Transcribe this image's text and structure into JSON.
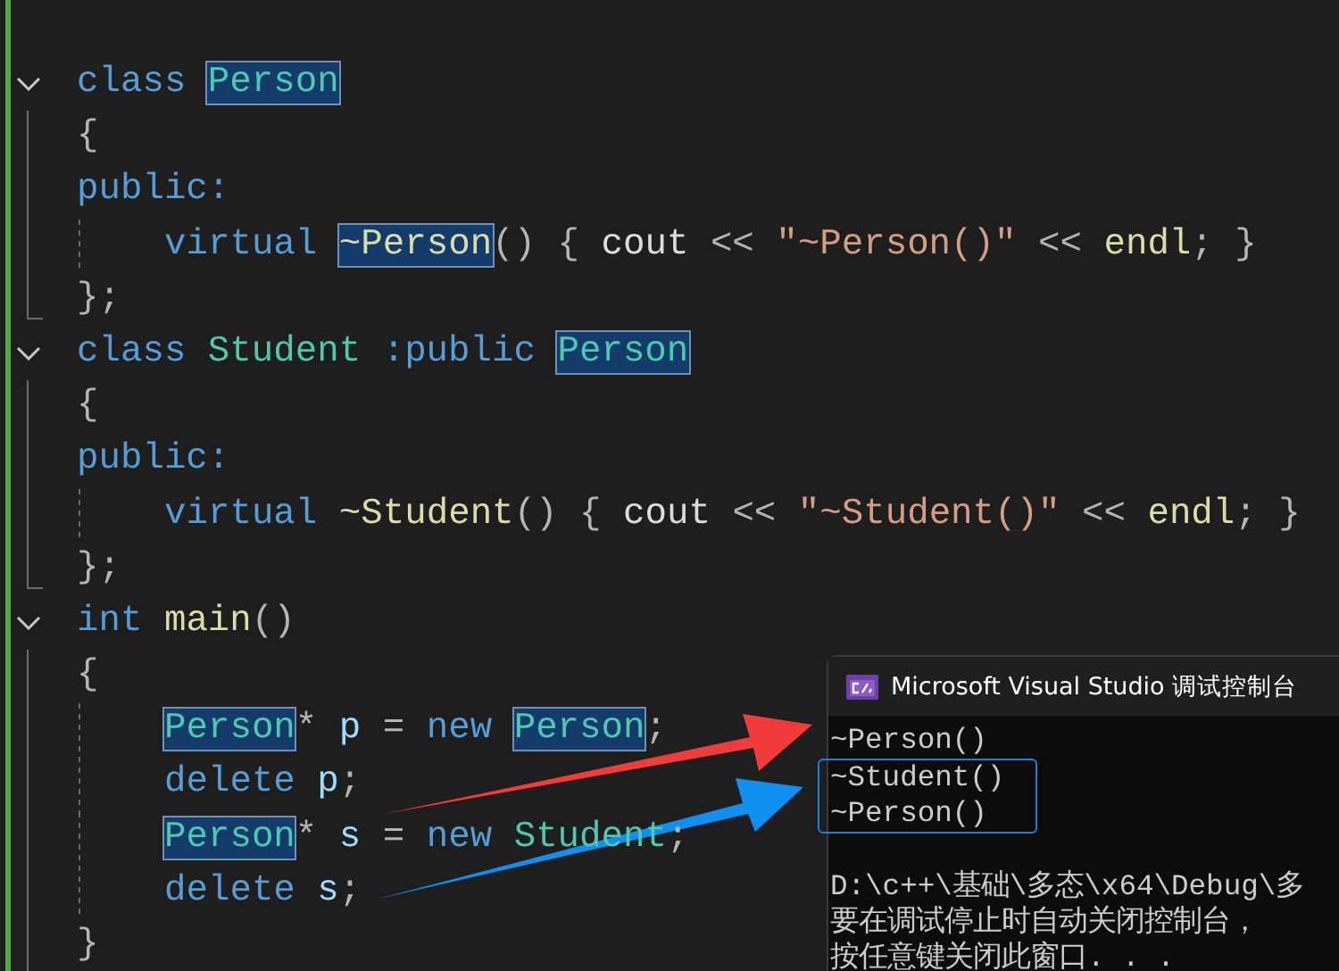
{
  "editor": {
    "lines": [
      {
        "collapsible": true,
        "block_end": false,
        "indented": false,
        "tokens": [
          {
            "t": "class ",
            "kind": "keyword"
          },
          {
            "t": "Person",
            "kind": "match-type"
          }
        ]
      },
      {
        "collapsible": false,
        "block_end": false,
        "indented": false,
        "tokens": [
          {
            "t": "{",
            "kind": "punct"
          }
        ]
      },
      {
        "collapsible": false,
        "block_end": false,
        "indented": false,
        "tokens": [
          {
            "t": "public:",
            "kind": "keyword"
          }
        ]
      },
      {
        "collapsible": false,
        "block_end": false,
        "indented": true,
        "tokens": [
          {
            "t": "virtual ",
            "kind": "keyword"
          },
          {
            "t": "~Person",
            "kind": "match-func"
          },
          {
            "t": "() { ",
            "kind": "punct"
          },
          {
            "t": "cout",
            "kind": "plain"
          },
          {
            "t": " << ",
            "kind": "punct"
          },
          {
            "t": "\"~Person()\"",
            "kind": "string"
          },
          {
            "t": " << ",
            "kind": "punct"
          },
          {
            "t": "endl",
            "kind": "func"
          },
          {
            "t": "; }",
            "kind": "punct"
          }
        ]
      },
      {
        "collapsible": false,
        "block_end": true,
        "indented": false,
        "tokens": [
          {
            "t": "};",
            "kind": "punct"
          }
        ]
      },
      {
        "collapsible": true,
        "block_end": false,
        "indented": false,
        "tokens": [
          {
            "t": "class ",
            "kind": "keyword"
          },
          {
            "t": "Student ",
            "kind": "type"
          },
          {
            "t": ":public ",
            "kind": "keyword"
          },
          {
            "t": "Person",
            "kind": "match-type"
          }
        ]
      },
      {
        "collapsible": false,
        "block_end": false,
        "indented": false,
        "tokens": [
          {
            "t": "{",
            "kind": "punct"
          }
        ]
      },
      {
        "collapsible": false,
        "block_end": false,
        "indented": false,
        "tokens": [
          {
            "t": "public:",
            "kind": "keyword"
          }
        ]
      },
      {
        "collapsible": false,
        "block_end": false,
        "indented": true,
        "tokens": [
          {
            "t": "virtual ",
            "kind": "keyword"
          },
          {
            "t": "~Student",
            "kind": "func"
          },
          {
            "t": "() { ",
            "kind": "punct"
          },
          {
            "t": "cout",
            "kind": "plain"
          },
          {
            "t": " << ",
            "kind": "punct"
          },
          {
            "t": "\"~Student()\"",
            "kind": "string"
          },
          {
            "t": " << ",
            "kind": "punct"
          },
          {
            "t": "endl",
            "kind": "func"
          },
          {
            "t": "; }",
            "kind": "punct"
          }
        ]
      },
      {
        "collapsible": false,
        "block_end": true,
        "indented": false,
        "tokens": [
          {
            "t": "};",
            "kind": "punct"
          }
        ]
      },
      {
        "collapsible": true,
        "block_end": false,
        "indented": false,
        "tokens": [
          {
            "t": "int ",
            "kind": "keyword"
          },
          {
            "t": "main",
            "kind": "func"
          },
          {
            "t": "()",
            "kind": "punct"
          }
        ]
      },
      {
        "collapsible": false,
        "block_end": false,
        "indented": false,
        "tokens": [
          {
            "t": "{",
            "kind": "punct"
          }
        ]
      },
      {
        "collapsible": false,
        "block_end": false,
        "indented": true,
        "tokens": [
          {
            "t": "Person",
            "kind": "match-type"
          },
          {
            "t": "* ",
            "kind": "punct"
          },
          {
            "t": "p",
            "kind": "var"
          },
          {
            "t": " = ",
            "kind": "punct"
          },
          {
            "t": "new ",
            "kind": "keyword"
          },
          {
            "t": "Person",
            "kind": "match-type"
          },
          {
            "t": ";",
            "kind": "punct"
          }
        ]
      },
      {
        "collapsible": false,
        "block_end": false,
        "indented": true,
        "tokens": [
          {
            "t": "delete ",
            "kind": "keyword"
          },
          {
            "t": "p",
            "kind": "var"
          },
          {
            "t": ";",
            "kind": "punct"
          }
        ]
      },
      {
        "collapsible": false,
        "block_end": false,
        "indented": true,
        "tokens": [
          {
            "t": "Person",
            "kind": "match-type"
          },
          {
            "t": "* ",
            "kind": "punct"
          },
          {
            "t": "s",
            "kind": "var"
          },
          {
            "t": " = ",
            "kind": "punct"
          },
          {
            "t": "new ",
            "kind": "keyword"
          },
          {
            "t": "Student",
            "kind": "type"
          },
          {
            "t": ";",
            "kind": "punct"
          }
        ]
      },
      {
        "collapsible": false,
        "block_end": false,
        "indented": true,
        "tokens": [
          {
            "t": "delete ",
            "kind": "keyword"
          },
          {
            "t": "s",
            "kind": "var"
          },
          {
            "t": ";",
            "kind": "punct"
          }
        ]
      },
      {
        "collapsible": false,
        "block_end": false,
        "indented": false,
        "tokens": [
          {
            "t": "}",
            "kind": "punct"
          }
        ]
      }
    ]
  },
  "console": {
    "title": "Microsoft Visual Studio 调试控制台",
    "output": [
      {
        "text": "~Person()",
        "boxed": false
      },
      {
        "text": "~Student()",
        "boxed": true
      },
      {
        "text": "~Person()",
        "boxed": true
      }
    ],
    "message": [
      {
        "text": "D:\\c++\\基础\\多态\\x64\\Debug\\多"
      },
      {
        "text": "要在调试停止时自动关闭控制台，"
      },
      {
        "text": "按任意键关闭此窗口. . ."
      }
    ]
  },
  "annotations": [
    {
      "kind": "arrow",
      "color": "#f23b3b"
    },
    {
      "kind": "arrow",
      "color": "#0f8ff0"
    }
  ]
}
